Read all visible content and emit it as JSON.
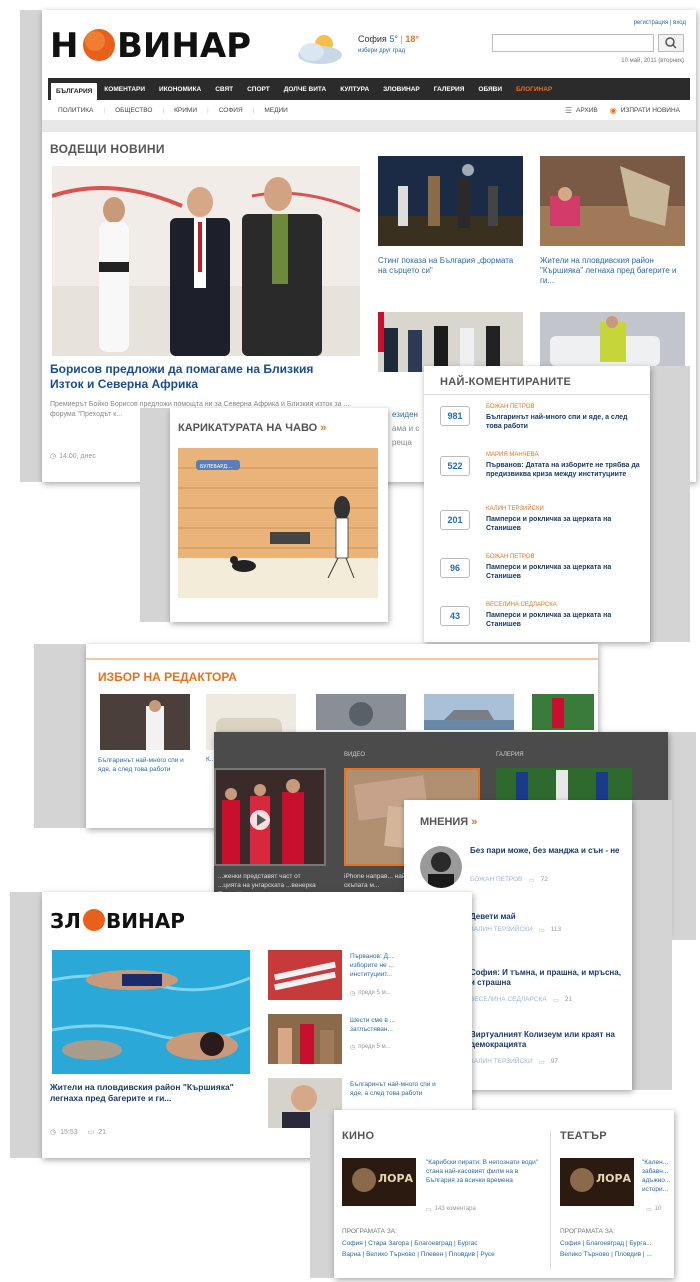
{
  "header": {
    "logo": "НОВИНАР",
    "weather_city": "София",
    "weather_low": "5°",
    "weather_sep": "|",
    "weather_high": "18°",
    "weather_choose": "избери друг град",
    "reg_link": "регистрация | вход",
    "search_placeholder": "",
    "date": "10 май, 2011 (вторник)"
  },
  "nav": {
    "main": [
      "БЪЛГАРИЯ",
      "КОМЕНТАРИ",
      "ИКОНОМИКА",
      "СВЯТ",
      "СПОРТ",
      "ДОЛЧЕ ВИТА",
      "КУЛТУРА",
      "ЗЛОВИНАР",
      "ГАЛЕРИЯ",
      "ОБЯВИ",
      "БЛОГИНАР"
    ],
    "sub": [
      "ПОЛИТИКА",
      "ОБЩЕСТВО",
      "КРИМИ",
      "СОФИЯ",
      "МЕДИИ"
    ],
    "archive": "АРХИВ",
    "send_news": "ИЗПРАТИ НОВИНА"
  },
  "leading": {
    "title": "ВОДЕЩИ НОВИНИ",
    "main_headline": "Борисов предложи да помагаме на Близкия Изток и Северна Африка",
    "main_excerpt": "Премиерът Бойко Борисов предложи помощта ни за Северна Африка и Близкия изток за ... форума \"Преходът к...",
    "main_time": "14:00, днес",
    "side1": "Стинг показа на България „формата на сърцето си\"",
    "side2": "Жители на пловдивския район \"Кършияка\" легнаха пред багерите и ги...",
    "partial1": "езиден",
    "partial2": "ама и с",
    "partial3": "реща"
  },
  "comments_box": {
    "title": "НАЙ-КОМЕНТИРАНИТЕ",
    "items": [
      {
        "count": "981",
        "author": "БОЖАН ПЕТРОВ",
        "text": "Българинът най-много спи и яде, а след това работи"
      },
      {
        "count": "522",
        "author": "МАРИЯ МАНЧЕВА",
        "text": "Първанов: Датата на изборите не трябва да предизвиква криза между институциите"
      },
      {
        "count": "201",
        "author": "КАЛИН ТЕРЗИЙСКИ",
        "text": "Памперси и рокличка за щерката на Станишев"
      },
      {
        "count": "96",
        "author": "БОЖАН ПЕТРОВ",
        "text": "Памперси и рокличка за щерката на Станишев"
      },
      {
        "count": "43",
        "author": "ВЕСЕЛИНА СЕДЛАРСКА",
        "text": "Памперси и рокличка за щерката на Станишев"
      }
    ]
  },
  "cartoon": {
    "title": "КАРИКАТУРАТА НА ЧАВО",
    "arrow": "»",
    "sign": "БУЛЕВАРД..."
  },
  "editor": {
    "title": "ИЗБОР НА РЕДАКТОРА",
    "item1": "Българинът най-много спи и яде, а след това работи",
    "partial": "К..."
  },
  "media": {
    "video_label": "ВИДЕО",
    "gallery_label": "ГАЛЕРИЯ",
    "caption1": "...женки представят част от ...цията на унгарската ...венерка Ерика Кьогиди",
    "caption2": "iPhone направ... най-скъпата м..."
  },
  "opinions": {
    "title": "МНЕНИЯ",
    "arrow": "»",
    "items": [
      {
        "text": "Без пари може, без манджа и сън - не",
        "author": "БОЖАН ПЕТРОВ",
        "count": "72"
      },
      {
        "text": "Девети май",
        "author": "КАЛИН ТЕРЗИЙСКИ",
        "count": "113"
      },
      {
        "text": "София: И тъмна, и прашна, и мръсна, и страшна",
        "author": "ВЕСЕЛИНА СЕДЛАРСКА",
        "count": "21"
      },
      {
        "text": "Виртуалният Колизеум или краят на демокрацията",
        "author": "КАЛИН ТЕРЗИЙСКИ",
        "count": "97"
      }
    ]
  },
  "zlovinar": {
    "logo": "ЗЛОВИНАР",
    "headline": "Жители на пловдивския район \"Кършияка\" легнаха пред багерите и ги...",
    "time": "15:53",
    "comments": "21",
    "side1": "Първанов: Д... изборите не ... институциит...",
    "side1_meta": "преди 5 м...",
    "side2": "Шести сме в ... затлъстяван...",
    "side2_meta": "преди 5 м...",
    "side3": "Българинът най-много спи и яде, а след това работи"
  },
  "culture": {
    "kino_title": "КИНО",
    "teatar_title": "ТЕАТЪР",
    "film_text": "\"Карибски пирати: В непознати води\" стана най-касовият филм на в България за всички времена",
    "film_comments": "143 коментара",
    "program": "ПРОГРАМАТА ЗА:",
    "cities1": "София | Стара Загора | Благоевград | Бургас",
    "cities2": "Варна | Велико Търново | Плевен | Пловдив | Русе",
    "t_cities1": "София | Благоевград | Бурга...",
    "t_cities2": "Велико Търново | Пловдив | ...",
    "poster_text": "ЛОРА",
    "t_text": "\"Кален... забавн... адъжно... истори...",
    "t_count": "10"
  }
}
